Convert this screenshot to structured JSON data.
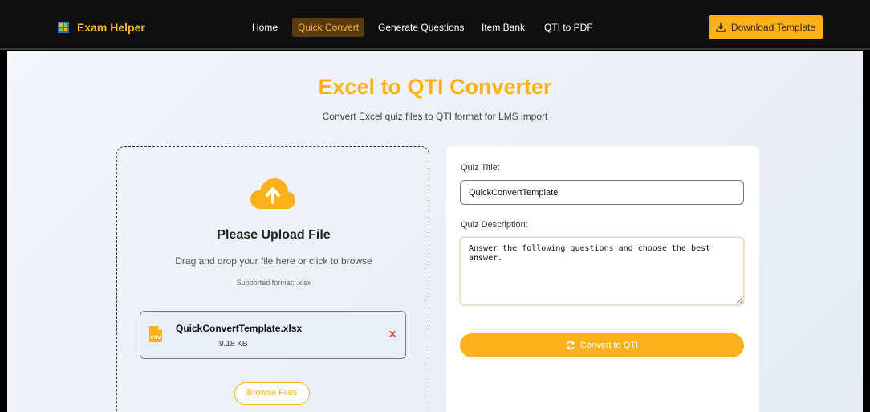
{
  "nav": {
    "brand": "Exam Helper",
    "links": [
      {
        "label": "Home",
        "active": false
      },
      {
        "label": "Quick Convert",
        "active": true
      },
      {
        "label": "Generate Questions",
        "active": false
      },
      {
        "label": "Item Bank",
        "active": false
      },
      {
        "label": "QTI to PDF",
        "active": false
      }
    ],
    "download_label": "Download Template"
  },
  "header": {
    "title": "Excel to QTI Converter",
    "subtitle": "Convert Excel quiz files to QTI format for LMS import"
  },
  "upload": {
    "heading": "Please Upload File",
    "hint": "Drag and drop your file here or click to browse",
    "format": "Supported format: .xlsx",
    "file": {
      "name": "QuickConvertTemplate.xlsx",
      "size": "9.18 KB",
      "remove": "✕",
      "icon_label": "CSV"
    },
    "browse_label": "Browse Files"
  },
  "form": {
    "title_label": "Quiz Title:",
    "title_value": "QuickConvertTemplate",
    "desc_label": "Quiz Description:",
    "desc_value": "Answer the following questions and choose the best answer.",
    "convert_label": "Convert to QTI"
  },
  "colors": {
    "accent": "#fbb11a",
    "navbar": "#0f0f0f",
    "danger": "#d9302c"
  },
  "icons": {
    "brand": "puzzle-logo-icon",
    "download": "download-icon",
    "upload": "cloud-upload-icon",
    "file": "file-csv-icon",
    "remove": "close-icon",
    "convert": "refresh-icon"
  }
}
